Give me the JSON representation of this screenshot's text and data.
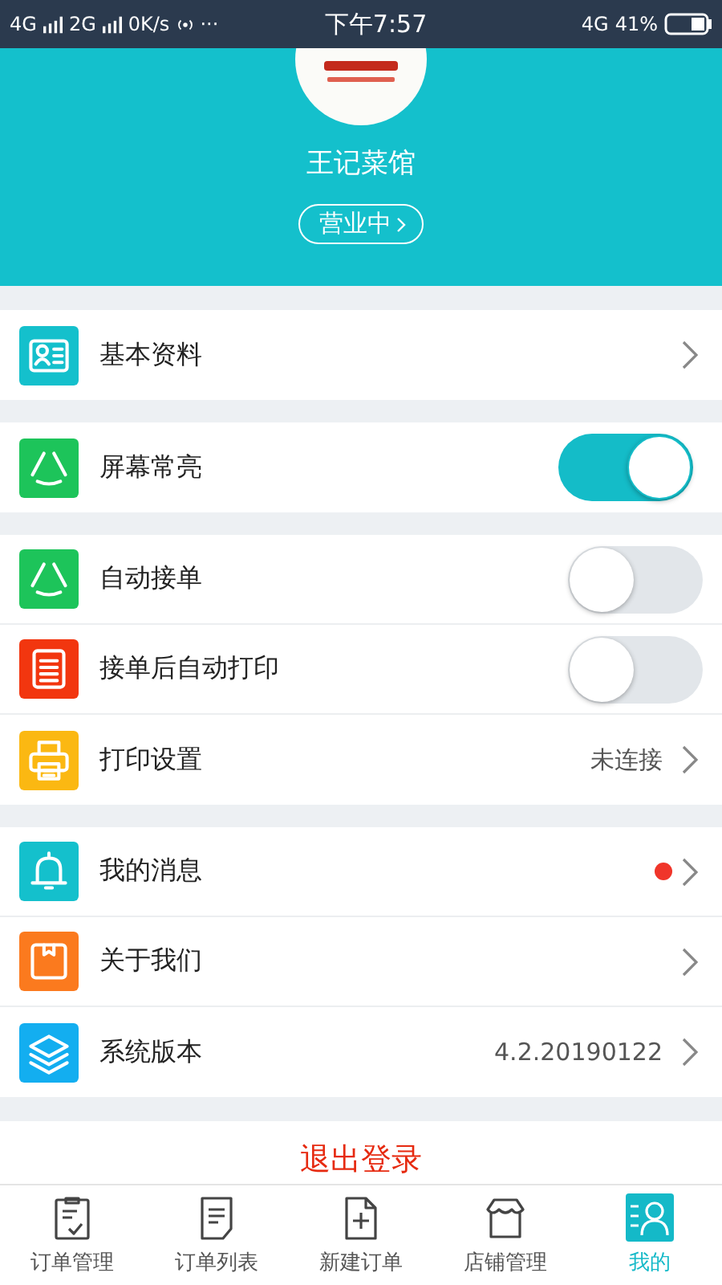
{
  "status_bar": {
    "network_1": "4G",
    "network_2": "2G",
    "speed": "0K/s",
    "more": "···",
    "time": "下午7:57",
    "network_3": "4G",
    "battery": "41%"
  },
  "profile": {
    "name": "王记菜馆",
    "status": "营业中"
  },
  "sections": [
    {
      "items": [
        {
          "kind": "link",
          "label": "基本资料"
        }
      ]
    },
    {
      "items": [
        {
          "kind": "toggle",
          "label": "屏幕常亮",
          "on": true
        }
      ]
    },
    {
      "items": [
        {
          "kind": "toggle",
          "label": "自动接单",
          "on": false
        },
        {
          "kind": "toggle",
          "label": "接单后自动打印",
          "on": false
        },
        {
          "kind": "link",
          "label": "打印设置",
          "value": "未连接"
        }
      ]
    },
    {
      "items": [
        {
          "kind": "link",
          "label": "我的消息",
          "unread": true
        },
        {
          "kind": "link",
          "label": "关于我们",
          "unread": false
        },
        {
          "kind": "link",
          "label": "系统版本",
          "value": "4.2.20190122"
        }
      ]
    }
  ],
  "logout": "退出登录",
  "tabs": [
    {
      "label": "订单管理",
      "selected": false
    },
    {
      "label": "订单列表",
      "selected": false
    },
    {
      "label": "新建订单",
      "selected": false
    },
    {
      "label": "店铺管理",
      "selected": false
    },
    {
      "label": "我的",
      "selected": true
    }
  ]
}
